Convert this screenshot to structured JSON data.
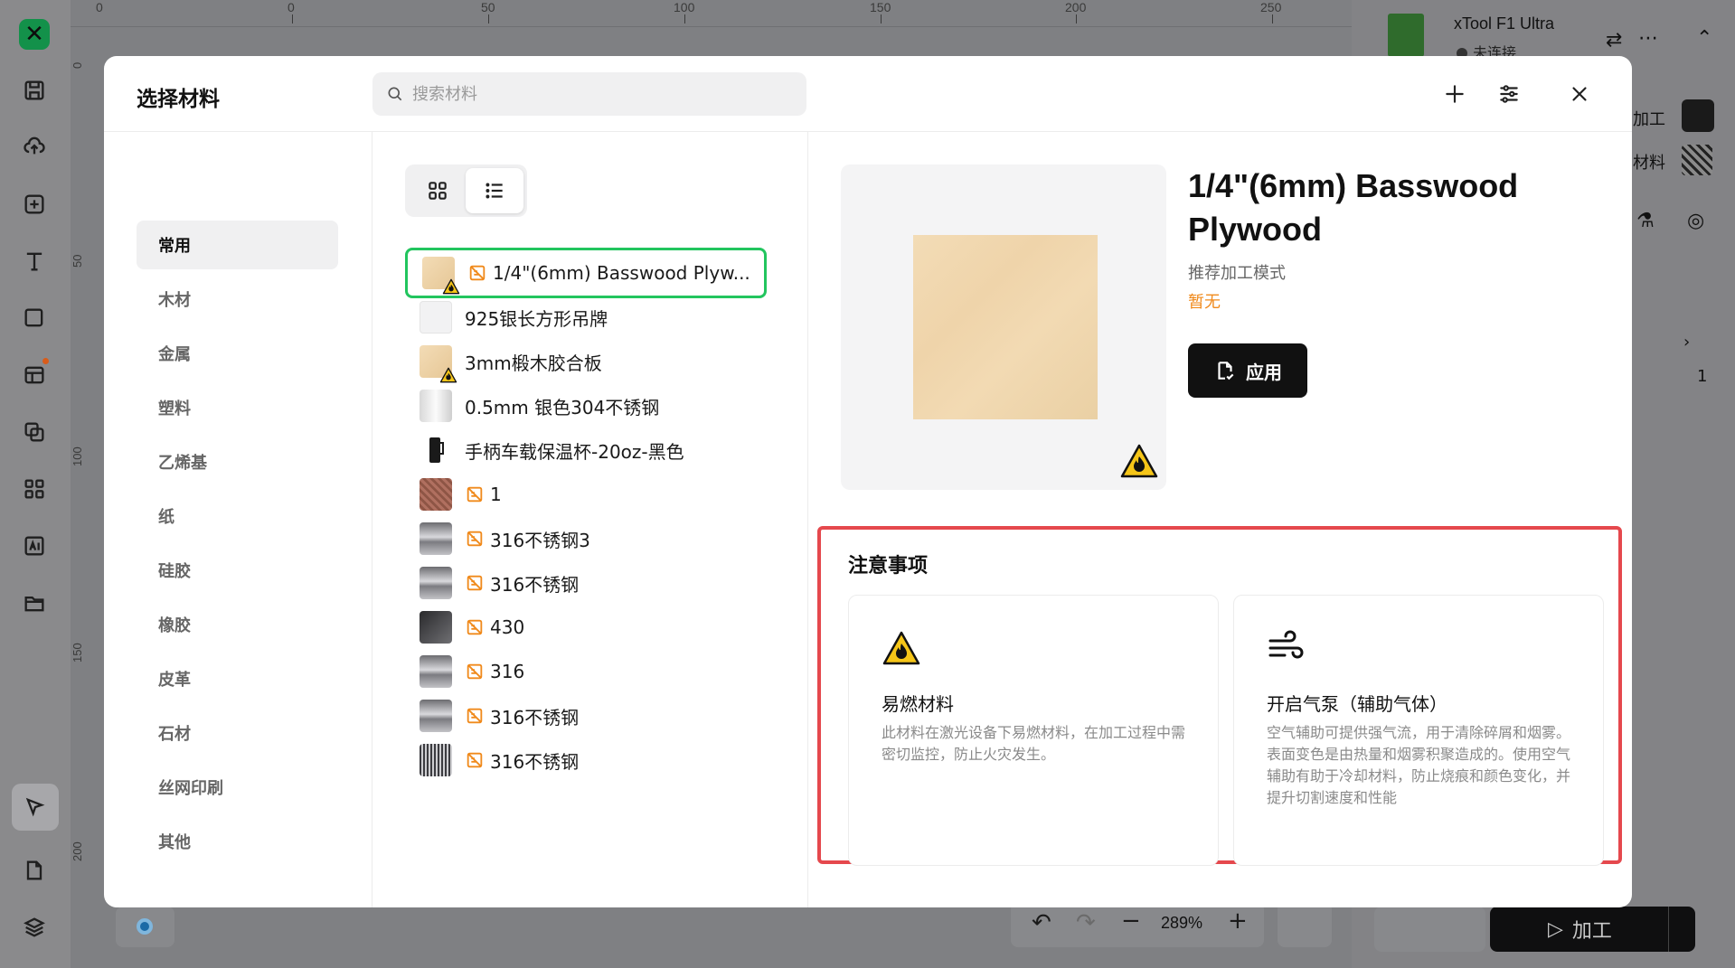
{
  "background": {
    "ruler_top_labels": [
      "0",
      "0",
      "50",
      "100",
      "150",
      "200",
      "250"
    ],
    "ruler_left_labels": [
      "0",
      "50",
      "100",
      "150",
      "200"
    ],
    "device": {
      "name": "xTool F1 Ultra",
      "status": "未连接"
    },
    "right_panel": {
      "process_label_partial": "加工",
      "material_label_partial": "材料",
      "count": "1"
    },
    "zoom": {
      "level": "289%"
    },
    "process_button": "加工"
  },
  "modal": {
    "title": "选择材料",
    "search": {
      "placeholder": "搜索材料",
      "value": ""
    },
    "categories": [
      {
        "label": "常用",
        "selected": true
      },
      {
        "label": "木材"
      },
      {
        "label": "金属"
      },
      {
        "label": "塑料"
      },
      {
        "label": "乙烯基"
      },
      {
        "label": "纸"
      },
      {
        "label": "硅胶"
      },
      {
        "label": "橡胶"
      },
      {
        "label": "皮革"
      },
      {
        "label": "石材"
      },
      {
        "label": "丝网印刷"
      },
      {
        "label": "其他"
      }
    ],
    "materials": [
      {
        "name": "1/4\"(6mm) Basswood Plyw...",
        "thumb": "wood",
        "warn": true,
        "tag": true,
        "selected": true
      },
      {
        "name": "925银长方形吊牌",
        "thumb": "white",
        "warn": false,
        "tag": false
      },
      {
        "name": "3mm椴木胶合板",
        "thumb": "wood",
        "warn": true,
        "tag": false
      },
      {
        "name": "0.5mm 银色304不锈钢",
        "thumb": "silver",
        "warn": false,
        "tag": false
      },
      {
        "name": "手柄车载保温杯-20oz-黑色",
        "thumb": "cup",
        "warn": false,
        "tag": false
      },
      {
        "name": "1",
        "thumb": "copper",
        "warn": false,
        "tag": true
      },
      {
        "name": "316不锈钢3",
        "thumb": "metal",
        "warn": false,
        "tag": true
      },
      {
        "name": "316不锈钢",
        "thumb": "metal",
        "warn": false,
        "tag": true
      },
      {
        "name": "430",
        "thumb": "dark",
        "warn": false,
        "tag": true
      },
      {
        "name": "316",
        "thumb": "metal",
        "warn": false,
        "tag": true
      },
      {
        "name": "316不锈钢",
        "thumb": "metal",
        "warn": false,
        "tag": true
      },
      {
        "name": "316不锈钢",
        "thumb": "stripe",
        "warn": false,
        "tag": true
      }
    ],
    "detail": {
      "title": "1/4\"(6mm) Basswood Plywood",
      "recommended_label": "推荐加工模式",
      "recommended_value": "暂无",
      "apply_label": "应用"
    },
    "notice": {
      "title": "注意事项",
      "cards": [
        {
          "icon": "flammable-warning-icon",
          "title": "易燃材料",
          "desc": "此材料在激光设备下易燃材料，在加工过程中需密切监控，防止火灾发生。"
        },
        {
          "icon": "air-pump-icon",
          "title": "开启气泵（辅助气体）",
          "desc": "空气辅助可提供强气流，用于清除碎屑和烟雾。表面变色是由热量和烟雾积聚造成的。使用空气辅助有助于冷却材料，防止烧痕和颜色变化，并提升切割速度和性能"
        }
      ]
    }
  },
  "colors": {
    "accent_green": "#22c55e",
    "warning_orange": "#f08a1c",
    "highlight_red": "#e5484d",
    "brand_green": "#13914a"
  }
}
